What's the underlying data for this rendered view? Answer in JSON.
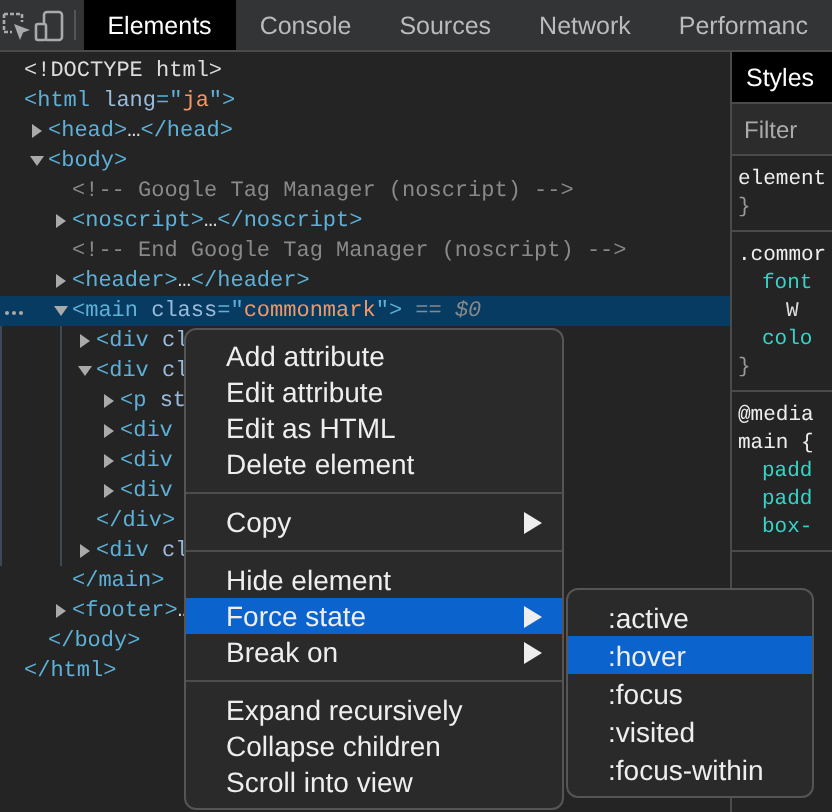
{
  "toolbar": {
    "tabs": [
      {
        "label": "Elements",
        "selected": true
      },
      {
        "label": "Console",
        "selected": false
      },
      {
        "label": "Sources",
        "selected": false
      },
      {
        "label": "Network",
        "selected": false
      },
      {
        "label": "Performanc",
        "selected": false
      }
    ]
  },
  "dom_tree": [
    {
      "selected": false,
      "parts": [
        {
          "kind": "plain",
          "text": "<!DOCTYPE html>"
        }
      ]
    },
    {
      "selected": false,
      "parts": [
        {
          "kind": "tag",
          "text": "<html "
        },
        {
          "kind": "attr",
          "text": "lang"
        },
        {
          "kind": "tag",
          "text": "=\""
        },
        {
          "kind": "value",
          "text": "ja"
        },
        {
          "kind": "tag",
          "text": "\">"
        }
      ],
      "children": [
        {
          "selected": false,
          "expanded": false,
          "parts": [
            {
              "kind": "tag",
              "text": "<head>"
            },
            {
              "kind": "plain",
              "text": "…"
            },
            {
              "kind": "tag",
              "text": "</head>"
            }
          ]
        },
        {
          "selected": false,
          "expanded": true,
          "parts": [
            {
              "kind": "tag",
              "text": "<body>"
            }
          ],
          "children": [
            {
              "selected": false,
              "parts": [
                {
                  "kind": "comment",
                  "text": "<!-- Google Tag Manager (noscript) -->"
                }
              ]
            },
            {
              "selected": false,
              "expanded": false,
              "parts": [
                {
                  "kind": "tag",
                  "text": "<noscript>"
                },
                {
                  "kind": "plain",
                  "text": "…"
                },
                {
                  "kind": "tag",
                  "text": "</noscript>"
                }
              ]
            },
            {
              "selected": false,
              "parts": [
                {
                  "kind": "comment",
                  "text": "<!-- End Google Tag Manager (noscript) -->"
                }
              ]
            },
            {
              "selected": false,
              "expanded": false,
              "parts": [
                {
                  "kind": "tag",
                  "text": "<header>"
                },
                {
                  "kind": "plain",
                  "text": "…"
                },
                {
                  "kind": "tag",
                  "text": "</header>"
                }
              ]
            },
            {
              "selected": true,
              "expanded": true,
              "parts": [
                {
                  "kind": "tag",
                  "text": "<main "
                },
                {
                  "kind": "attr",
                  "text": "class"
                },
                {
                  "kind": "tag",
                  "text": "=\""
                },
                {
                  "kind": "value",
                  "text": "commonmark"
                },
                {
                  "kind": "tag",
                  "text": "\">"
                },
                {
                  "kind": "marker",
                  "text": " == $0"
                }
              ],
              "children": [
                {
                  "selected": false,
                  "expanded": false,
                  "parts": [
                    {
                      "kind": "tag",
                      "text": "<div "
                    },
                    {
                      "kind": "attr",
                      "text": "cl"
                    }
                  ]
                },
                {
                  "selected": false,
                  "expanded": true,
                  "parts": [
                    {
                      "kind": "tag",
                      "text": "<div "
                    },
                    {
                      "kind": "attr",
                      "text": "cl"
                    }
                  ],
                  "children": [
                    {
                      "selected": false,
                      "expanded": false,
                      "parts": [
                        {
                          "kind": "tag",
                          "text": "<p "
                        },
                        {
                          "kind": "attr",
                          "text": "st"
                        }
                      ]
                    },
                    {
                      "selected": false,
                      "expanded": false,
                      "parts": [
                        {
                          "kind": "tag",
                          "text": "<div"
                        }
                      ]
                    },
                    {
                      "selected": false,
                      "expanded": false,
                      "parts": [
                        {
                          "kind": "tag",
                          "text": "<div"
                        }
                      ]
                    },
                    {
                      "selected": false,
                      "expanded": false,
                      "parts": [
                        {
                          "kind": "tag",
                          "text": "<div"
                        }
                      ]
                    }
                  ],
                  "closing": [
                    {
                      "kind": "tag",
                      "text": "</div>"
                    }
                  ]
                },
                {
                  "selected": false,
                  "expanded": false,
                  "parts": [
                    {
                      "kind": "tag",
                      "text": "<div "
                    },
                    {
                      "kind": "attr",
                      "text": "cl"
                    }
                  ]
                }
              ],
              "closing": [
                {
                  "kind": "tag",
                  "text": "</main>"
                }
              ]
            },
            {
              "selected": false,
              "expanded": false,
              "parts": [
                {
                  "kind": "tag",
                  "text": "<footer>"
                },
                {
                  "kind": "plain",
                  "text": "…"
                }
              ]
            }
          ],
          "closing": [
            {
              "kind": "tag",
              "text": "</body>"
            }
          ]
        }
      ],
      "closing": [
        {
          "kind": "tag",
          "text": "</html>"
        }
      ]
    }
  ],
  "context_menu": {
    "groups": [
      [
        {
          "label": "Add attribute",
          "has_submenu": false,
          "selected": false
        },
        {
          "label": "Edit attribute",
          "has_submenu": false,
          "selected": false
        },
        {
          "label": "Edit as HTML",
          "has_submenu": false,
          "selected": false
        },
        {
          "label": "Delete element",
          "has_submenu": false,
          "selected": false
        }
      ],
      [
        {
          "label": "Copy",
          "has_submenu": true,
          "selected": false
        }
      ],
      [
        {
          "label": "Hide element",
          "has_submenu": false,
          "selected": false
        },
        {
          "label": "Force state",
          "has_submenu": true,
          "selected": true
        },
        {
          "label": "Break on",
          "has_submenu": true,
          "selected": false
        }
      ],
      [
        {
          "label": "Expand recursively",
          "has_submenu": false,
          "selected": false
        },
        {
          "label": "Collapse children",
          "has_submenu": false,
          "selected": false
        },
        {
          "label": "Scroll into view",
          "has_submenu": false,
          "selected": false
        }
      ]
    ]
  },
  "submenu": {
    "items": [
      {
        "label": ":active",
        "selected": false
      },
      {
        "label": ":hover",
        "selected": true
      },
      {
        "label": ":focus",
        "selected": false
      },
      {
        "label": ":visited",
        "selected": false
      },
      {
        "label": ":focus-within",
        "selected": false
      }
    ]
  },
  "styles_pane": {
    "tab": "Styles",
    "filter": {
      "placeholder": "Filter"
    },
    "rules": [
      [
        {
          "kind": "selector",
          "text": "element"
        },
        {
          "kind": "brace",
          "text": "}"
        }
      ],
      [
        {
          "kind": "selector",
          "text": ".commor"
        },
        {
          "kind": "prop",
          "text": "font"
        },
        {
          "kind": "value",
          "text": "W"
        },
        {
          "kind": "prop",
          "text": "colo"
        },
        {
          "kind": "brace",
          "text": "}"
        }
      ],
      [
        {
          "kind": "selector",
          "text": "@media"
        },
        {
          "kind": "selector",
          "text": "main {"
        },
        {
          "kind": "prop",
          "text": "padd"
        },
        {
          "kind": "prop",
          "text": "padd"
        },
        {
          "kind": "prop",
          "text": "box-"
        }
      ]
    ]
  }
}
